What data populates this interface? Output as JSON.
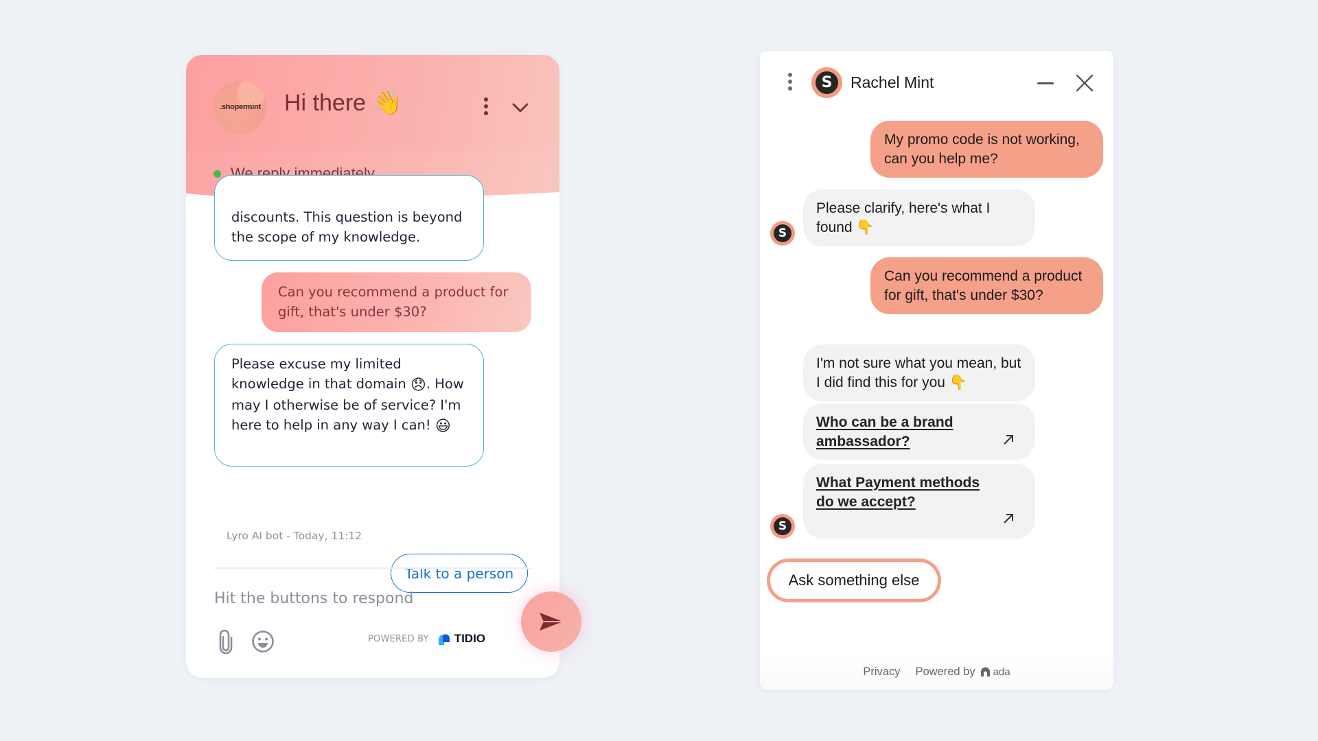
{
  "tidio_widget": {
    "header": {
      "brand_avatar_text": ".shopermint",
      "title": "Hi there",
      "title_emoji": "👋",
      "status_text": "We reply immediately",
      "status_color": "#4cb74a",
      "header_gradient": [
        "#fd9fa0",
        "#f9c4bc"
      ]
    },
    "messages": [
      {
        "sender": "bot",
        "text": "discounts. This question is beyond the scope of my knowledge.",
        "clipped_top": true
      },
      {
        "sender": "user",
        "text": "Can you recommend a product for gift, that's under $30?"
      },
      {
        "sender": "bot",
        "text_before_emoji": "Please excuse my limited knowledge in that domain ",
        "emoji_1": "😞",
        "text_mid": ". How may I otherwise be of service? I'm here to help in any way I can! ",
        "emoji_2": "😃"
      }
    ],
    "bot_meta": "Lyro AI bot - Today, 11:12",
    "quick_reply": "Talk to a person",
    "input": {
      "placeholder": "Hit the buttons to respond",
      "value": ""
    },
    "footer": {
      "powered_by": "POWERED BY",
      "brand": "TIDIO"
    },
    "icons": [
      "shopermint-logo",
      "kebab-menu-icon",
      "chevron-down-icon",
      "paperclip-icon",
      "emoji-icon",
      "tidio-logo-icon",
      "send-icon"
    ],
    "accent_link_color": "#1570d9",
    "bot_border_color": "#49b4d8"
  },
  "ada_widget": {
    "header": {
      "agent_name": "Rachel Mint",
      "avatar_letter": "S"
    },
    "messages": [
      {
        "sender": "user",
        "text": "My promo code is not working, can you help me?"
      },
      {
        "sender": "bot",
        "text": "Please clarify, here's what I found",
        "emoji": "👇"
      },
      {
        "sender": "user",
        "text": "Can you recommend a product for gift, that's under $30?"
      },
      {
        "sender": "bot",
        "text": "I'm not sure what you mean, but I did find this for you",
        "emoji": "👇"
      },
      {
        "sender": "bot-link",
        "text": "Who can be a brand ambassador?"
      },
      {
        "sender": "bot-link",
        "text": "What Payment methods do we accept?"
      }
    ],
    "quick_reply": "Ask something else",
    "footer": {
      "privacy": "Privacy",
      "powered_by": "Powered by",
      "brand": "ada"
    },
    "user_bubble_color": "#f5a089",
    "bot_bubble_color": "#f2f2f2"
  }
}
